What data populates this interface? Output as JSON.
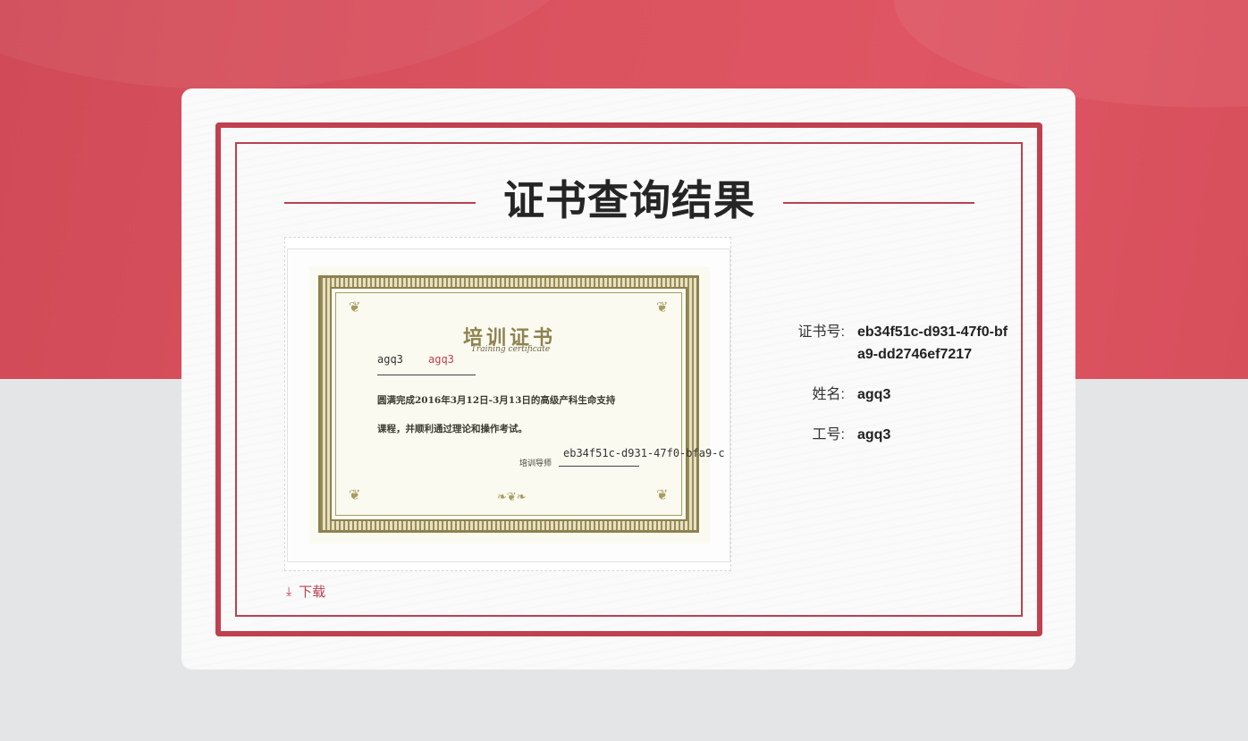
{
  "page": {
    "title": "证书查询结果"
  },
  "certificate": {
    "heading_cn": "培训证书",
    "heading_en": "Training certificate",
    "name_left": "agq3",
    "name_right": "agq3",
    "body_line1": "圆满完成2016年3月12日-3月13日的高级产科生命支持",
    "body_line2": "课程，并顺利通过理论和操作考试。",
    "teacher_label": "培训导师",
    "number_overlay": "eb34f51c-d931-47f0-bfa9-c"
  },
  "info": {
    "rows": [
      {
        "label": "证书号:",
        "value": "eb34f51c-d931-47f0-bfa9-dd2746ef7217"
      },
      {
        "label": "姓名:",
        "value": "agq3"
      },
      {
        "label": "工号:",
        "value": "agq3"
      }
    ]
  },
  "download": {
    "label": "下载",
    "icon": "download-icon"
  },
  "colors": {
    "accent": "#c0404f",
    "header_bg": "#dc5360",
    "page_bg": "#e4e5e7"
  }
}
